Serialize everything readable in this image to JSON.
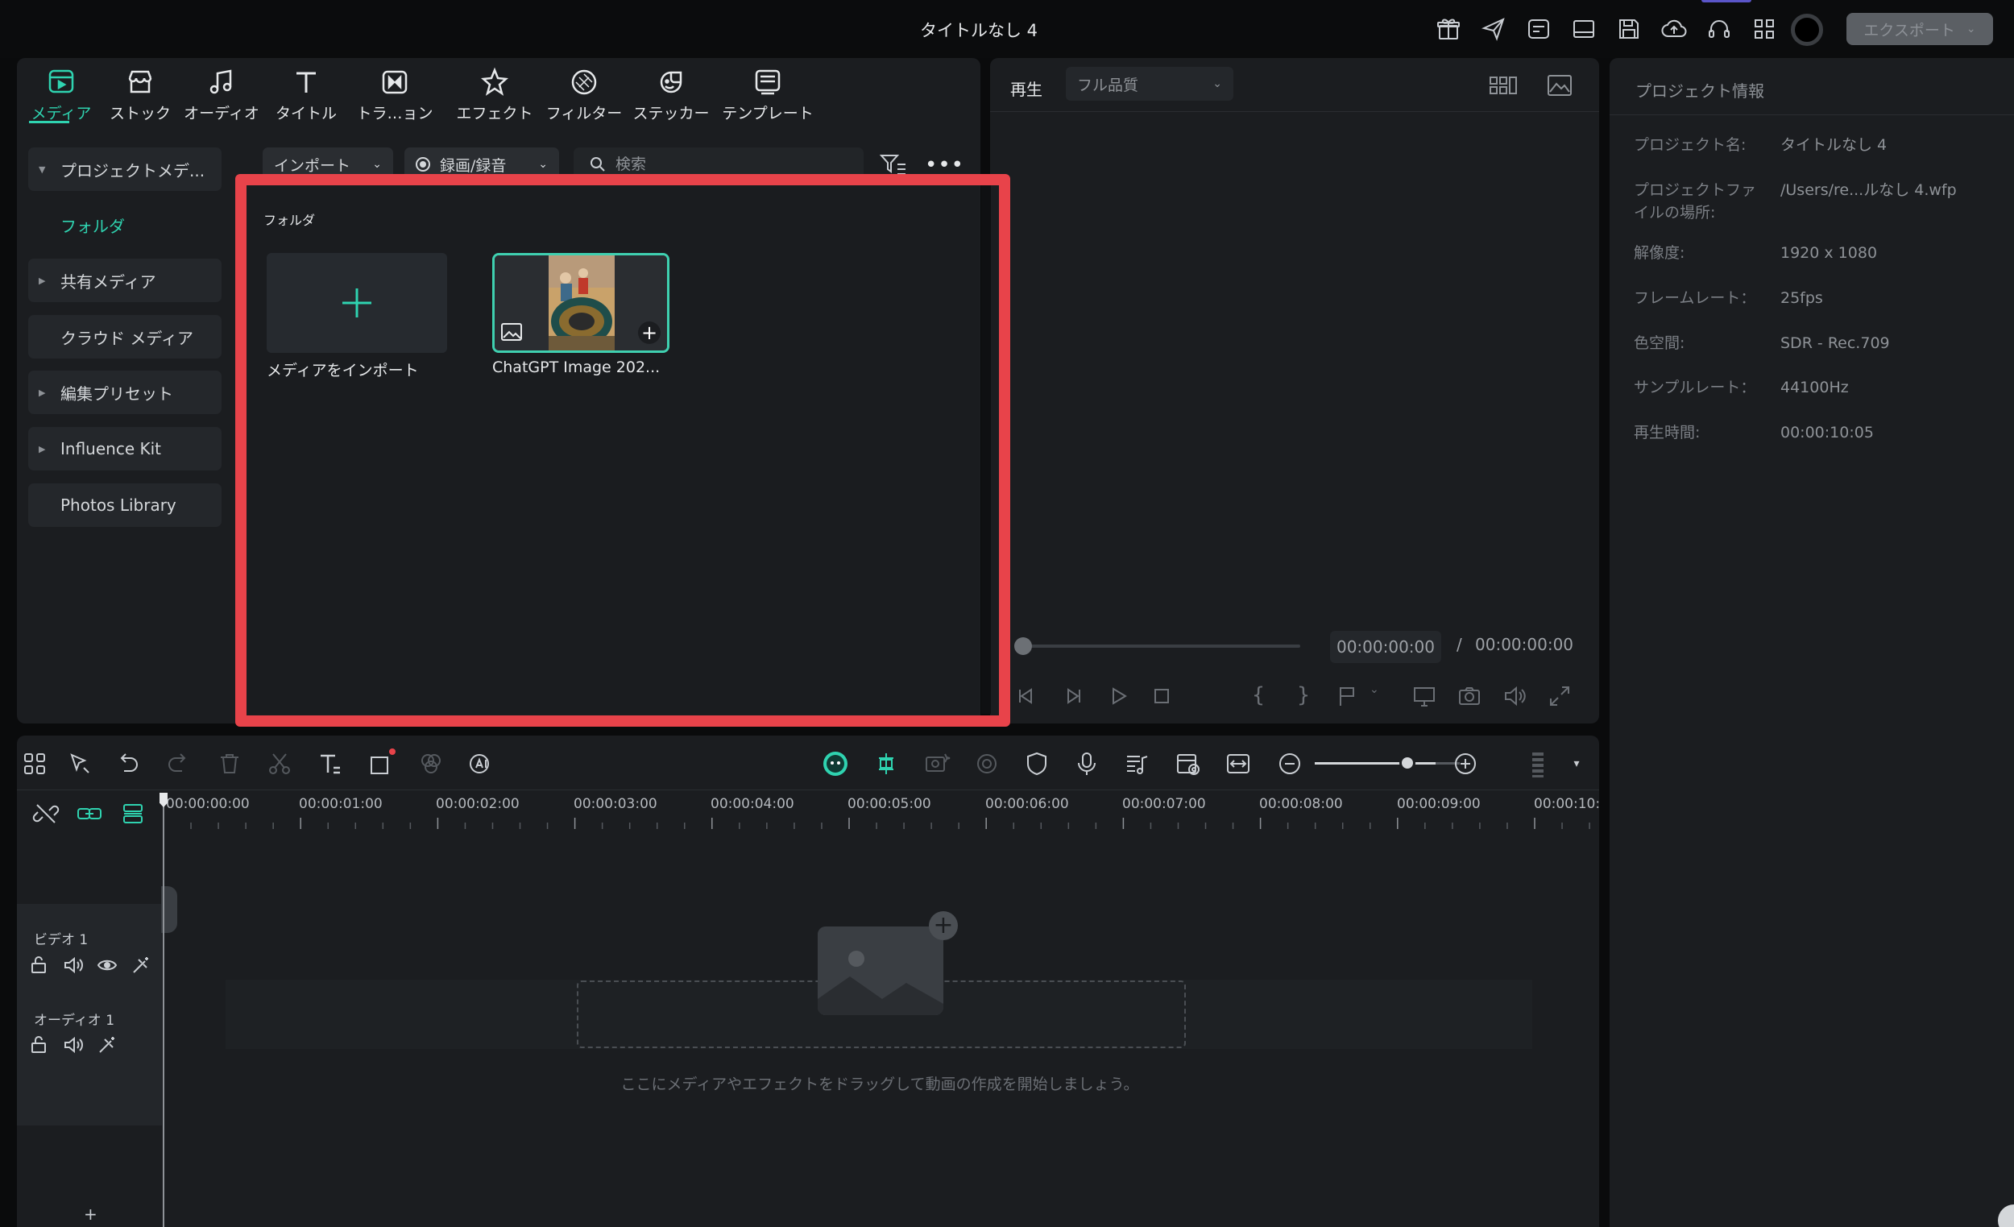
{
  "window": {
    "title": "タイトルなし 4",
    "export_label": "エクスポート"
  },
  "media_tabs": [
    {
      "label": "メディア",
      "icon": "media-icon"
    },
    {
      "label": "ストック",
      "icon": "stock-icon"
    },
    {
      "label": "オーディオ",
      "icon": "audio-icon"
    },
    {
      "label": "タイトル",
      "icon": "title-icon"
    },
    {
      "label": "トラ…ョン",
      "icon": "transition-icon"
    },
    {
      "label": "エフェクト",
      "icon": "effect-icon"
    },
    {
      "label": "フィルター",
      "icon": "filter-icon"
    },
    {
      "label": "ステッカー",
      "icon": "sticker-icon"
    },
    {
      "label": "テンプレート",
      "icon": "template-icon"
    }
  ],
  "sidebar": {
    "project_media": "プロジェクトメデ...",
    "folder": "フォルダ",
    "shared_media": "共有メディア",
    "cloud_media": "クラウド メディア",
    "edit_presets": "編集プリセット",
    "influence_kit": "Influence Kit",
    "photos_library": "Photos Library"
  },
  "media_toolbar": {
    "import_label": "インポート",
    "record_label": "録画/録音",
    "search_placeholder": "検索"
  },
  "media_content": {
    "folder_label": "フォルダ",
    "import_tile_label": "メディアをインポート",
    "image_tile_label": "ChatGPT Image 202..."
  },
  "player": {
    "tab_label": "再生",
    "quality": "フル品質",
    "time_current": "00:00:00:00",
    "time_separator": "/",
    "time_total": "00:00:00:00"
  },
  "project_info": {
    "title": "プロジェクト情報",
    "rows": [
      {
        "key": "プロジェクト名:",
        "value": "タイトルなし 4"
      },
      {
        "key_line1": "プロジェクトファ",
        "key_line2": "イルの場所:",
        "value": "/Users/re...ルなし 4.wfp"
      },
      {
        "key": "解像度:",
        "value": "1920 x 1080"
      },
      {
        "key": "フレームレート：",
        "value": "25fps"
      },
      {
        "key": "色空間:",
        "value": "SDR - Rec.709"
      },
      {
        "key": "サンプルレート：",
        "value": "44100Hz"
      },
      {
        "key": "再生時間:",
        "value": "00:00:10:05"
      }
    ]
  },
  "timeline": {
    "ruler": [
      "00:00:00:00",
      "00:00:01:00",
      "00:00:02:00",
      "00:00:03:00",
      "00:00:04:00",
      "00:00:05:00",
      "00:00:06:00",
      "00:00:07:00",
      "00:00:08:00",
      "00:00:09:00",
      "00:00:10:"
    ],
    "video_track": "ビデオ 1",
    "audio_track": "オーディオ 1",
    "drop_hint": "ここにメディアやエフェクトをドラッグして動画の作成を開始しましょう。",
    "add_track": "+"
  },
  "colors": {
    "accent": "#2fd3b0",
    "highlight_frame": "#e8434a",
    "panel": "#1b1d20"
  }
}
